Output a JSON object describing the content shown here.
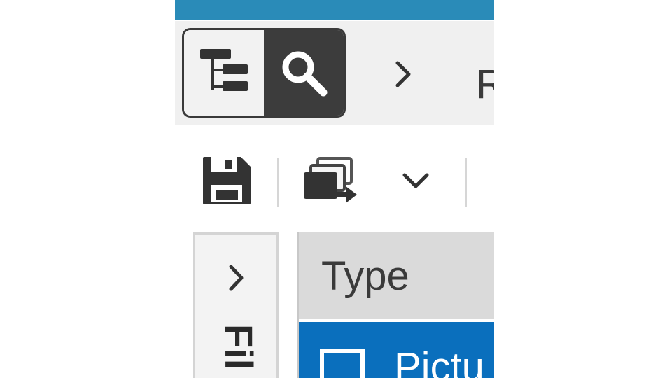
{
  "app": {
    "title_bar_color": "#2a8bb8"
  },
  "nav": {
    "modes": [
      {
        "name": "tree-view",
        "icon": "tree-structure-icon",
        "selected": false
      },
      {
        "name": "search-view",
        "icon": "search-icon",
        "selected": true
      }
    ],
    "breadcrumb": {
      "separator_icon": "chevron-right-icon",
      "first_item": "R"
    }
  },
  "toolbar": {
    "items": [
      {
        "icon": "save-icon"
      },
      {
        "icon": "move-to-icon"
      },
      {
        "icon": "chevron-down-icon"
      }
    ]
  },
  "side_panel": {
    "expand_icon": "chevron-right-icon",
    "label": "Fil"
  },
  "grid": {
    "columns": [
      "Type"
    ],
    "rows": [
      {
        "type": "Pictu",
        "selected": true
      }
    ],
    "selection_color": "#0a6fbd"
  }
}
